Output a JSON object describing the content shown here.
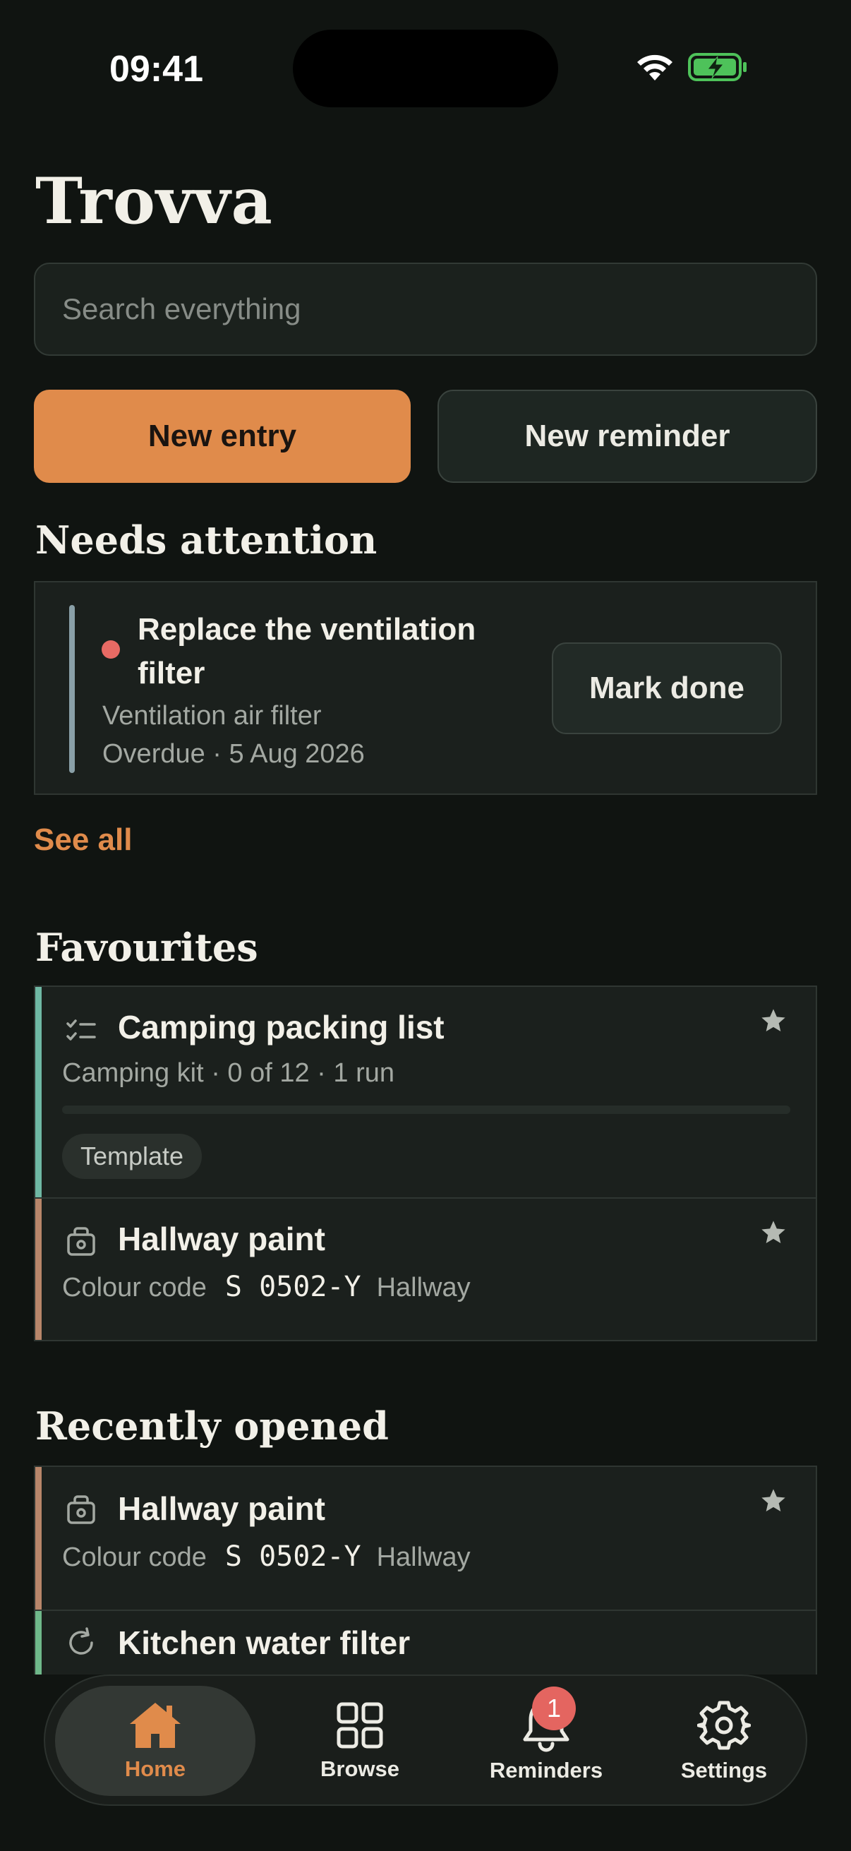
{
  "status_bar": {
    "time": "09:41"
  },
  "app": {
    "title": "Trovva"
  },
  "search": {
    "placeholder": "Search everything"
  },
  "actions": {
    "new_entry": "New entry",
    "new_reminder": "New reminder"
  },
  "needs_attention": {
    "heading": "Needs attention",
    "item": {
      "title": "Replace the ventilation filter",
      "subtitle": "Ventilation air filter",
      "due": "Overdue · 5 Aug 2026",
      "action": "Mark done",
      "status_color": "#e86a64"
    },
    "see_all": "See all"
  },
  "favourites": {
    "heading": "Favourites",
    "items": [
      {
        "icon": "checklist-icon",
        "title": "Camping packing list",
        "meta": "Camping kit · 0 of 12 · 1 run",
        "progress": 0,
        "tag": "Template",
        "starred": true,
        "accent": "#6fb8a4"
      },
      {
        "icon": "paint-bucket-icon",
        "title": "Hallway paint",
        "label": "Colour code",
        "code": "S 0502-Y",
        "location": "Hallway",
        "starred": true,
        "accent": "#b8866a"
      }
    ]
  },
  "recently_opened": {
    "heading": "Recently opened",
    "items": [
      {
        "icon": "paint-bucket-icon",
        "title": "Hallway paint",
        "label": "Colour code",
        "code": "S 0502-Y",
        "location": "Hallway",
        "starred": true,
        "accent": "#b8866a"
      },
      {
        "icon": "refresh-icon",
        "title": "Kitchen water filter",
        "accent": "#6fb88a"
      }
    ]
  },
  "tab_bar": {
    "tabs": [
      {
        "label": "Home",
        "icon": "home-icon",
        "active": true
      },
      {
        "label": "Browse",
        "icon": "grid-icon",
        "active": false
      },
      {
        "label": "Reminders",
        "icon": "bell-icon",
        "active": false,
        "badge": "1"
      },
      {
        "label": "Settings",
        "icon": "gear-icon",
        "active": false
      }
    ]
  },
  "colors": {
    "accent": "#e08b4b",
    "background": "#101411",
    "card": "#1b201d"
  }
}
